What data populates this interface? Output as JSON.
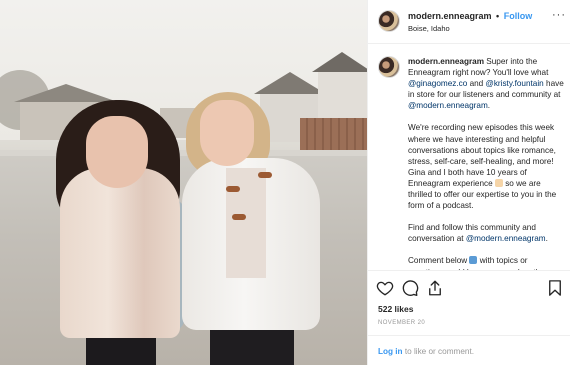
{
  "post": {
    "username": "modern.enneagram",
    "separator": "•",
    "follow_label": "Follow",
    "location": "Boise, Idaho",
    "more_glyph": "···"
  },
  "caption": {
    "username": "modern.enneagram",
    "p1_text1": " Super into the Enneagram right now? You'll love what ",
    "mention1": "@ginagomez.co",
    "p1_and": " and ",
    "mention2": "@kristy.fountain",
    "p1_text2": " have in store for our listeners and community at ",
    "mention3": "@modern.enneagram",
    "p1_end": ".",
    "p2_text": "We're recording new episodes this week where we have interesting and helpful conversations about topics like romance, stress, self-care, self-healing, and more! Gina and I both have 10 years of Enneagram experience ",
    "p2_end": " so we are thrilled to offer our expertise to you in the form of a podcast.",
    "p3_text": "Find and follow this community and conversation at ",
    "mention4": "@modern.enneagram",
    "p3_end": ".",
    "p4_text1": "Comment below ",
    "p4_text2": "  with topics or questions you'd love answered on the"
  },
  "actions": {
    "like_icon": "heart-icon",
    "comment_icon": "comment-icon",
    "share_icon": "share-icon",
    "save_icon": "bookmark-icon",
    "likes": "522 likes",
    "date": "NOVEMBER 20"
  },
  "login": {
    "link": "Log in",
    "text": " to like or comment."
  },
  "colors": {
    "link_blue": "#3897f0",
    "mention_navy": "#003569",
    "muted": "#999999",
    "border": "#efefef"
  }
}
